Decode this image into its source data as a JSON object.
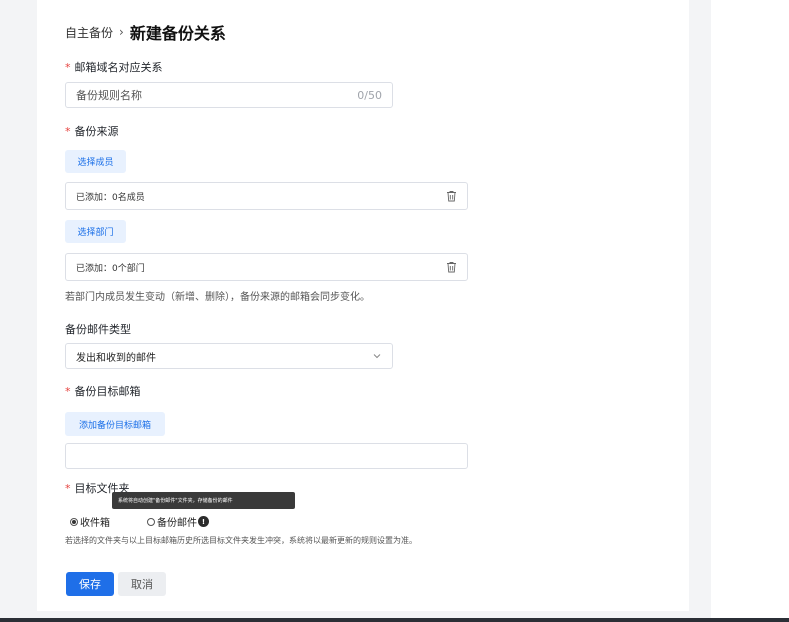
{
  "breadcrumb": {
    "parent": "自主备份",
    "separator": "›",
    "current": "新建备份关系"
  },
  "rule_name": {
    "label": "邮箱域名对应关系",
    "placeholder": "备份规则名称",
    "counter": "0/50"
  },
  "source": {
    "label": "备份来源",
    "select_members_button": "选择成员",
    "members_added": "已添加：0名成员",
    "select_departments_button": "选择部门",
    "departments_added": "已添加：0个部门",
    "hint": "若部门内成员发生变动（新增、删除），备份来源的邮箱会同步变化。"
  },
  "mail_type": {
    "label": "备份邮件类型",
    "selected": "发出和收到的邮件"
  },
  "target_mailbox": {
    "label": "备份目标邮箱",
    "add_button": "添加备份目标邮箱",
    "value": ""
  },
  "target_folder": {
    "label": "目标文件夹",
    "tooltip": "系统将自动创建\"备份邮件\"文件夹，存储备份的邮件",
    "options": [
      {
        "label": "收件箱",
        "selected": true
      },
      {
        "label": "备份邮件",
        "selected": false
      }
    ],
    "info_glyph": "!",
    "hint": "若选择的文件夹与以上目标邮箱历史所选目标文件夹发生冲突，系统将以最新更新的规则设置为准。"
  },
  "actions": {
    "save": "保存",
    "cancel": "取消"
  },
  "colors": {
    "primary": "#1f6fe8",
    "required": "#e64340",
    "light_button_bg": "#e8f1fe"
  },
  "icons": {
    "trash": "trash-icon",
    "chevron": "chevron-down-icon",
    "info": "info-icon"
  }
}
